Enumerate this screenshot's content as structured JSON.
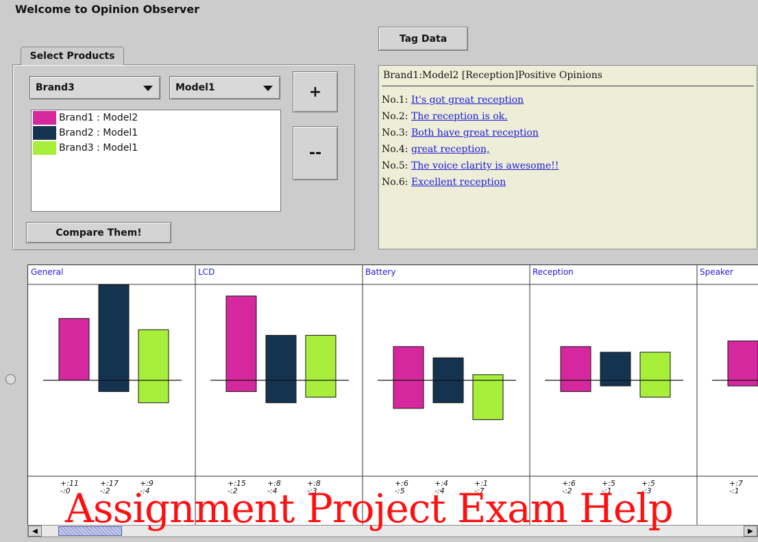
{
  "window": {
    "title": "Welcome to Opinion Observer"
  },
  "toolbar": {
    "tag_data_label": "Tag Data"
  },
  "select_panel": {
    "tab_label": "Select Products",
    "brand_select": "Brand3",
    "model_select": "Model1",
    "add_label": "+",
    "remove_label": "--",
    "compare_label": "Compare Them!",
    "items": [
      {
        "label": "Brand1 : Model2",
        "color": "#d6289e"
      },
      {
        "label": "Brand2 : Model1",
        "color": "#14334f"
      },
      {
        "label": "Brand3 : Model1",
        "color": "#a8ef3c"
      }
    ]
  },
  "opinions": {
    "header": "Brand1:Model2 [Reception]Positive Opinions",
    "items": [
      {
        "num": "No.1: ",
        "text": "It's got great reception "
      },
      {
        "num": "No.2: ",
        "text": "The reception is ok. "
      },
      {
        "num": "No.3: ",
        "text": "Both have great reception "
      },
      {
        "num": "No.4: ",
        "text": "great reception, "
      },
      {
        "num": "No.5: ",
        "text": "The voice clarity is awesome!! "
      },
      {
        "num": "No.6: ",
        "text": "Excellent reception "
      }
    ]
  },
  "chart_data": {
    "type": "bar",
    "series_colors": [
      "#d6289e",
      "#14334f",
      "#a8ef3c"
    ],
    "categories": [
      {
        "name": "General",
        "pos": [
          11,
          17,
          9
        ],
        "neg": [
          0,
          2,
          4
        ]
      },
      {
        "name": "LCD",
        "pos": [
          15,
          8,
          8
        ],
        "neg": [
          2,
          4,
          3
        ]
      },
      {
        "name": "Battery",
        "pos": [
          6,
          4,
          1
        ],
        "neg": [
          5,
          4,
          7
        ]
      },
      {
        "name": "Reception",
        "pos": [
          6,
          5,
          5
        ],
        "neg": [
          2,
          1,
          3
        ]
      },
      {
        "name": "Speaker",
        "pos": [
          7
        ],
        "neg": [
          1
        ]
      }
    ]
  },
  "watermark": {
    "text": "Assignment Project Exam Help"
  },
  "scrollbar": {
    "left_arrow": "◀",
    "right_arrow": "▶"
  }
}
